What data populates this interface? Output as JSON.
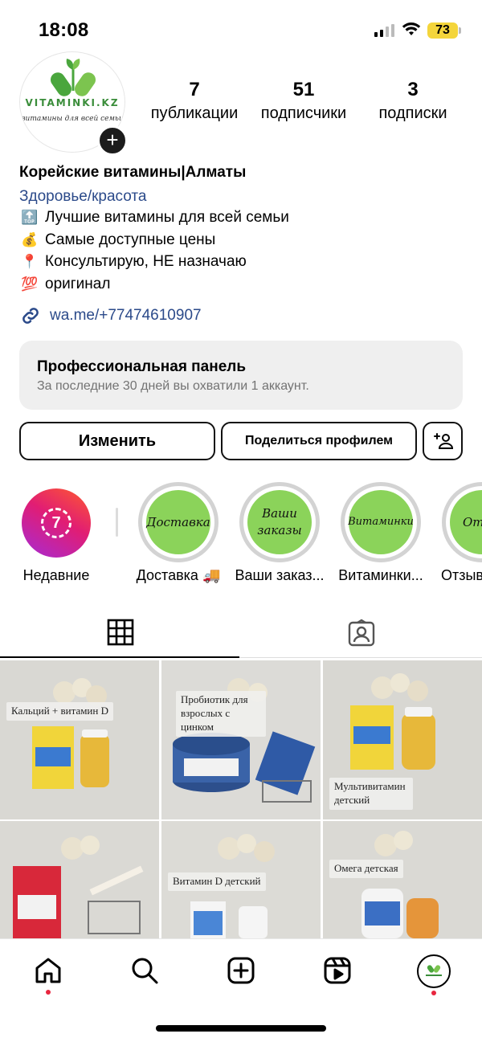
{
  "status": {
    "time": "18:08",
    "battery": "73"
  },
  "profile": {
    "logo_title": "VITAMINKI.KZ",
    "logo_subtitle": "витамины для всей семьи",
    "stats": [
      {
        "number": "7",
        "label": "публикации"
      },
      {
        "number": "51",
        "label": "подписчики"
      },
      {
        "number": "3",
        "label": "подписки"
      }
    ],
    "name": "Корейские витамины|Алматы",
    "category": "Здоровье/красота",
    "bio": [
      {
        "emoji": "🔝",
        "text": "Лучшие витамины для всей семьи"
      },
      {
        "emoji": "💰",
        "text": "Самые доступные цены"
      },
      {
        "emoji": "📍",
        "text": "Консультирую, НЕ назначаю"
      },
      {
        "emoji": "💯",
        "text": "оригинал"
      }
    ],
    "link": "wa.me/+77474610907"
  },
  "pro_panel": {
    "title": "Профессиональная панель",
    "subtitle": "За последние 30 дней вы охватили 1 аккаунт."
  },
  "buttons": {
    "edit": "Изменить",
    "share": "Поделиться профилем"
  },
  "highlights": {
    "recent_badge": "7",
    "items": [
      {
        "label": "Недавние"
      },
      {
        "cover": "Доставка",
        "label": "Доставка 🚚"
      },
      {
        "cover": "Ваши заказы",
        "label": "Ваши заказ..."
      },
      {
        "cover": "Витаминки",
        "label": "Витаминки..."
      },
      {
        "cover": "Отз",
        "label": "Отзыв"
      }
    ]
  },
  "posts": [
    {
      "caption": "Кальций + витамин D"
    },
    {
      "caption": "Пробиотик для взрослых с цинком"
    },
    {
      "caption": "Мультивитамин детский"
    },
    {
      "caption": ""
    },
    {
      "caption": "Витамин D детский"
    },
    {
      "caption": "Омега детская"
    }
  ],
  "colors": {
    "link": "#2b4a8a",
    "highlight_fill": "#8bd35a",
    "notification_dot": "#e8263f",
    "battery": "#f4d53b"
  }
}
